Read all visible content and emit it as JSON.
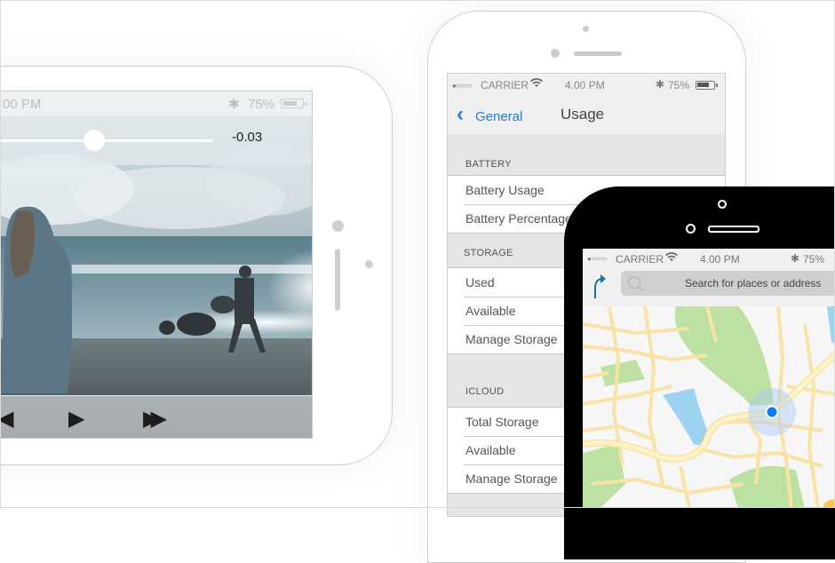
{
  "landscape_player": {
    "status": {
      "time": "00 PM",
      "bluetooth_icon": "bluetooth-icon",
      "battery_percent": "75%"
    },
    "scrubber": {
      "progress": 0.44,
      "remaining_time": "-0.03"
    },
    "controls": [
      {
        "name": "rewind",
        "glyph": "◀"
      },
      {
        "name": "play",
        "glyph": "▶"
      },
      {
        "name": "fast-forward",
        "glyph": "▶▶"
      }
    ]
  },
  "settings_phone": {
    "status": {
      "signal": "●○○○○",
      "carrier": "CARRIER",
      "wifi_icon": "wifi-icon",
      "time": "4.00 PM",
      "battery_percent": "75%"
    },
    "nav": {
      "back_label": "General",
      "title": "Usage"
    },
    "sections": [
      {
        "header": "BATTERY",
        "rows": [
          "Battery Usage",
          "Battery Percentage"
        ]
      },
      {
        "header": "STORAGE",
        "rows": [
          "Used",
          "Available",
          "Manage Storage"
        ]
      },
      {
        "header": "ICLOUD",
        "rows": [
          "Total Storage",
          "Available",
          "Manage Storage"
        ]
      }
    ]
  },
  "maps_phone": {
    "status": {
      "signal": "●○○○○",
      "carrier": "CARRIER",
      "wifi_icon": "wifi-icon",
      "time": "4.00 PM",
      "battery_percent": "75%"
    },
    "search": {
      "placeholder": "Search for places or address"
    },
    "colors": {
      "location_dot": "#0a7cf5",
      "water": "#9dd3f0",
      "park": "#bde1a2",
      "road": "#f8e2a6"
    }
  }
}
